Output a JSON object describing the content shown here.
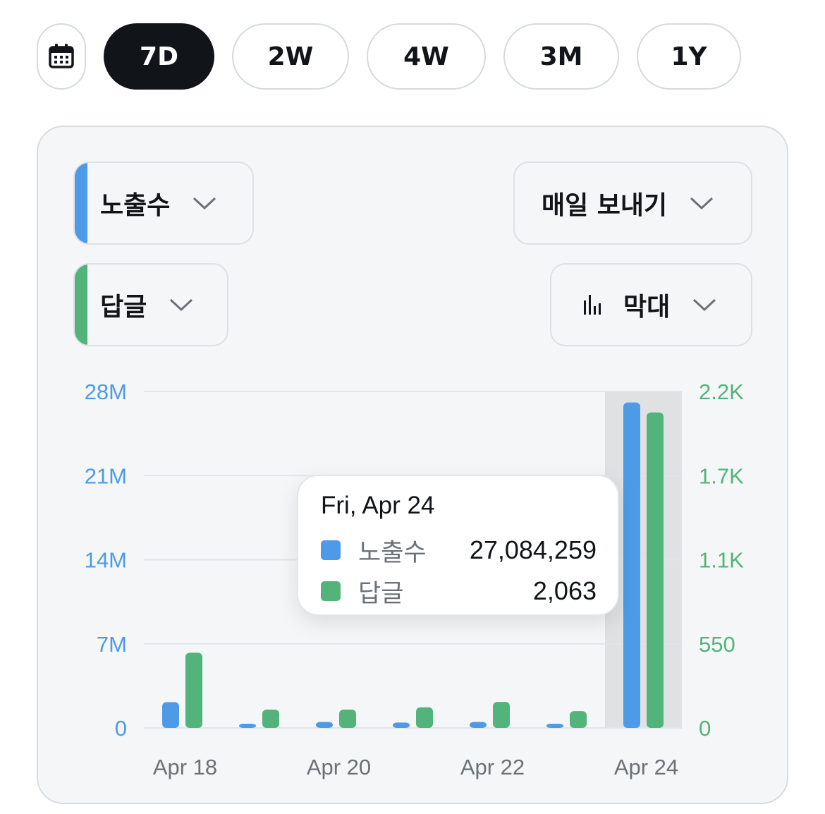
{
  "range_selector": {
    "calendar_icon": "calendar-icon",
    "options": [
      "7D",
      "2W",
      "4W",
      "3M",
      "1Y"
    ],
    "selected": "7D"
  },
  "controls": {
    "metric1": {
      "label": "노출수",
      "color": "#4d9be8"
    },
    "metric2": {
      "label": "답글",
      "color": "#52b47a"
    },
    "frequency": {
      "label": "매일 보내기"
    },
    "chart_type": {
      "label": "막대",
      "icon": "bar-chart-icon"
    }
  },
  "tooltip": {
    "date": "Fri, Apr 24",
    "rows": [
      {
        "name": "노출수",
        "value": "27,084,259",
        "color": "#4d9be8"
      },
      {
        "name": "답글",
        "value": "2,063",
        "color": "#52b47a"
      }
    ]
  },
  "chart_data": {
    "type": "bar",
    "categories": [
      "Apr 18",
      "Apr 19",
      "Apr 20",
      "Apr 21",
      "Apr 22",
      "Apr 23",
      "Apr 24"
    ],
    "x_tick_labels": [
      "Apr 18",
      "",
      "Apr 20",
      "",
      "Apr 22",
      "",
      "Apr 24"
    ],
    "highlighted_category": "Apr 24",
    "series": [
      {
        "name": "노출수",
        "axis": "left",
        "color": "#4d9be8",
        "values": [
          2150000,
          350000,
          500000,
          450000,
          500000,
          230000,
          27084259
        ]
      },
      {
        "name": "답글",
        "axis": "right",
        "color": "#52b47a",
        "values": [
          492,
          120,
          120,
          135,
          170,
          110,
          2063
        ]
      }
    ],
    "y_left": {
      "ticks": [
        0,
        7000000,
        14000000,
        21000000,
        28000000
      ],
      "tick_labels": [
        "0",
        "7M",
        "14M",
        "21M",
        "28M"
      ],
      "ylim": [
        0,
        28000000
      ],
      "color": "#4d9be8"
    },
    "y_right": {
      "ticks": [
        0,
        550,
        1100,
        1650,
        2200
      ],
      "tick_labels": [
        "0",
        "550",
        "1.1K",
        "1.7K",
        "2.2K"
      ],
      "ylim": [
        0,
        2200
      ],
      "color": "#52b47a"
    },
    "grid": true
  }
}
